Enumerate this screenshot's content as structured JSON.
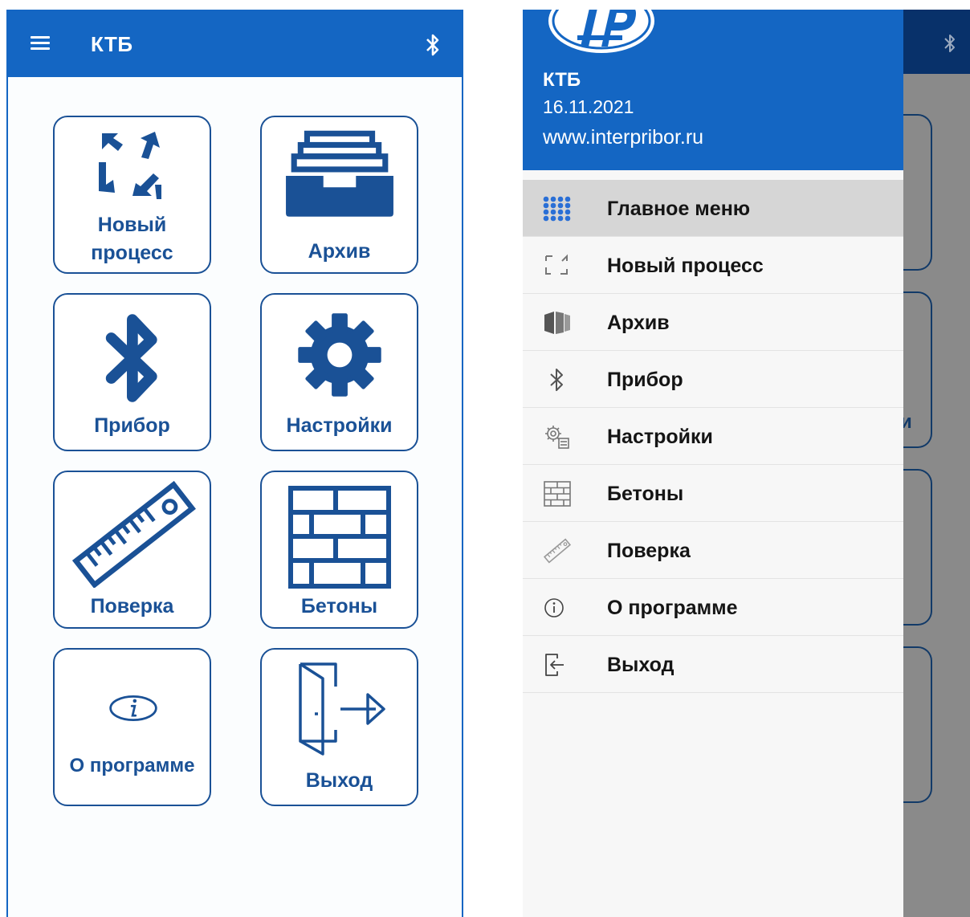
{
  "main_screen": {
    "app_title": "КТБ",
    "tiles": [
      {
        "id": "new-process",
        "label_line1": "Новый",
        "label_line2": "процесс"
      },
      {
        "id": "archive",
        "label": "Архив"
      },
      {
        "id": "device",
        "label": "Прибор"
      },
      {
        "id": "settings",
        "label": "Настройки"
      },
      {
        "id": "verification",
        "label": "Поверка"
      },
      {
        "id": "concretes",
        "label": "Бетоны"
      },
      {
        "id": "about",
        "label": "О программе"
      },
      {
        "id": "exit",
        "label": "Выход"
      }
    ]
  },
  "drawer": {
    "app_name": "КТБ",
    "date": "16.11.2021",
    "website": "www.interpribor.ru",
    "ghost_letter": "и",
    "items": [
      {
        "label": "Главное меню",
        "icon": "grid-icon",
        "active": true
      },
      {
        "label": "Новый процесс",
        "icon": "new-process-icon",
        "active": false
      },
      {
        "label": "Архив",
        "icon": "archive-icon",
        "active": false
      },
      {
        "label": "Прибор",
        "icon": "bluetooth-icon",
        "active": false
      },
      {
        "label": "Настройки",
        "icon": "settings-icon",
        "active": false
      },
      {
        "label": "Бетоны",
        "icon": "brick-wall-icon",
        "active": false
      },
      {
        "label": "Поверка",
        "icon": "ruler-icon",
        "active": false
      },
      {
        "label": "О программе",
        "icon": "info-icon",
        "active": false
      },
      {
        "label": "Выход",
        "icon": "exit-icon",
        "active": false
      }
    ]
  },
  "colors": {
    "primary": "#1466c3",
    "tile_border": "#1a5196",
    "active_item": "#d6d6d6",
    "scrim": "#8a8a8a"
  }
}
